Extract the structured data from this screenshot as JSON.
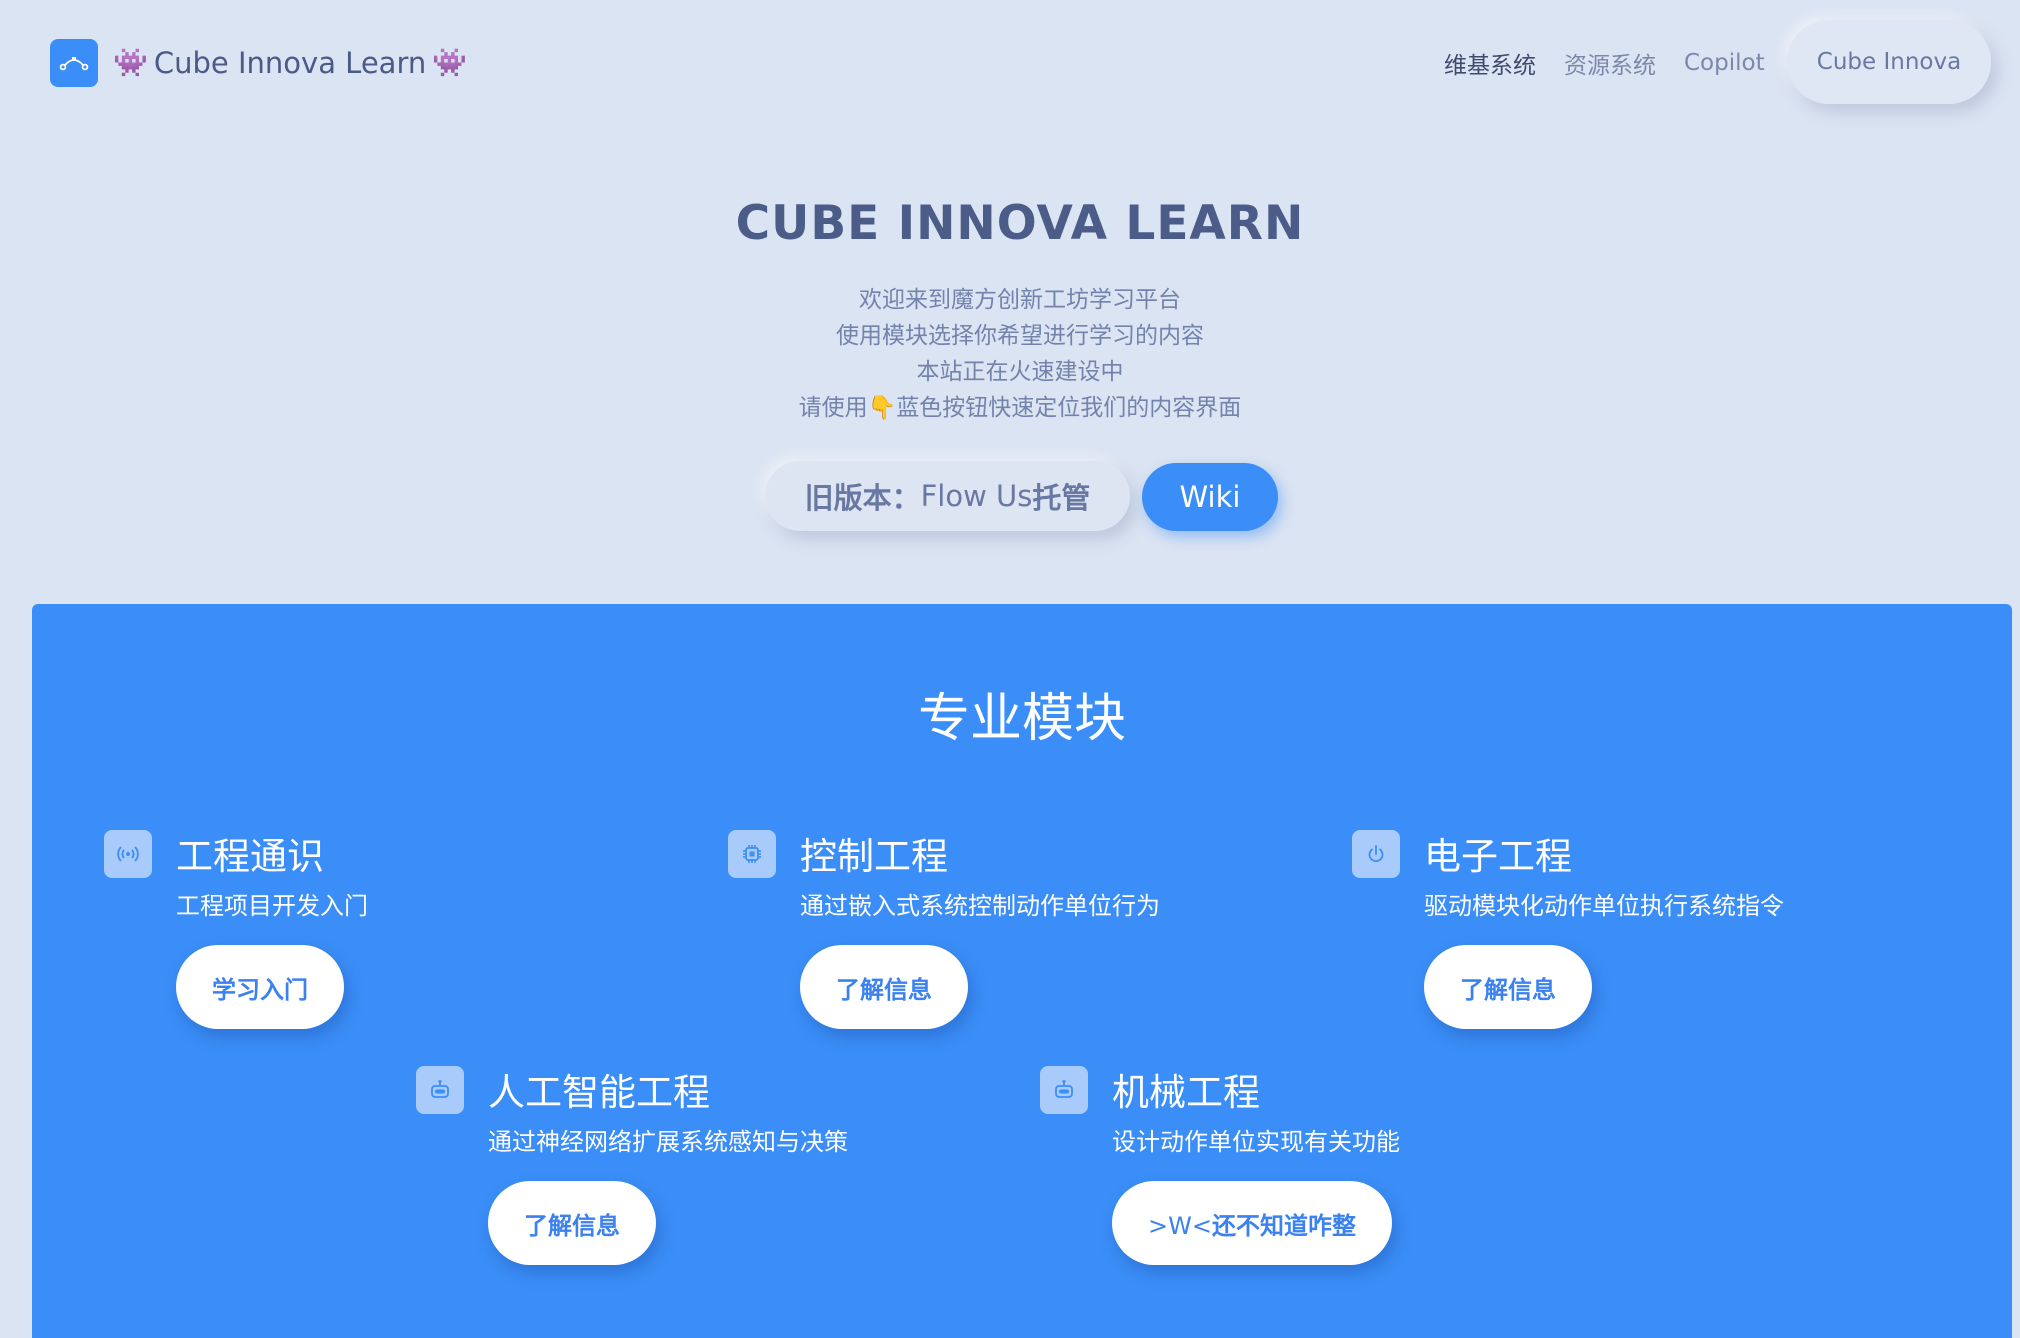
{
  "header": {
    "brand_alien_left": "👾",
    "brand_title": "Cube Innova Learn",
    "brand_alien_right": "👾",
    "nav": [
      "维基系统",
      "资源系统",
      "Copilot"
    ],
    "cta_label": "Cube Innova"
  },
  "hero": {
    "title": "CUBE INNOVA LEARN",
    "lines": [
      "欢迎来到魔方创新工坊学习平台",
      "使用模块选择你希望进行学习的内容",
      "本站正在火速建设中",
      "请使用👇蓝色按钮快速定位我们的内容界面"
    ],
    "old_version_prefix": "旧版本：",
    "old_version_mid": "Flow Us",
    "old_version_suffix": "托管",
    "wiki_label": "Wiki"
  },
  "modules": {
    "title": "专业模块",
    "items": [
      {
        "icon": "antenna-icon",
        "title": "工程通识",
        "subtitle": "工程项目开发入门",
        "button": "学习入门"
      },
      {
        "icon": "chip-icon",
        "title": "控制工程",
        "subtitle": "通过嵌入式系统控制动作单位行为",
        "button": "了解信息"
      },
      {
        "icon": "power-icon",
        "title": "电子工程",
        "subtitle": "驱动模块化动作单位执行系统指令",
        "button": "了解信息"
      },
      {
        "icon": "robot-icon",
        "title": "人工智能工程",
        "subtitle": "通过神经网络扩展系统感知与决策",
        "button": "了解信息"
      },
      {
        "icon": "robot-icon",
        "title": "机械工程",
        "subtitle": "设计动作单位实现有关功能",
        "button_prefix": ">W<",
        "button_suffix": "还不知道咋整"
      }
    ]
  },
  "colors": {
    "background": "#dbe4f2",
    "accent": "#3b8ef7",
    "heading": "#4b5c89",
    "muted": "#7383ab"
  }
}
